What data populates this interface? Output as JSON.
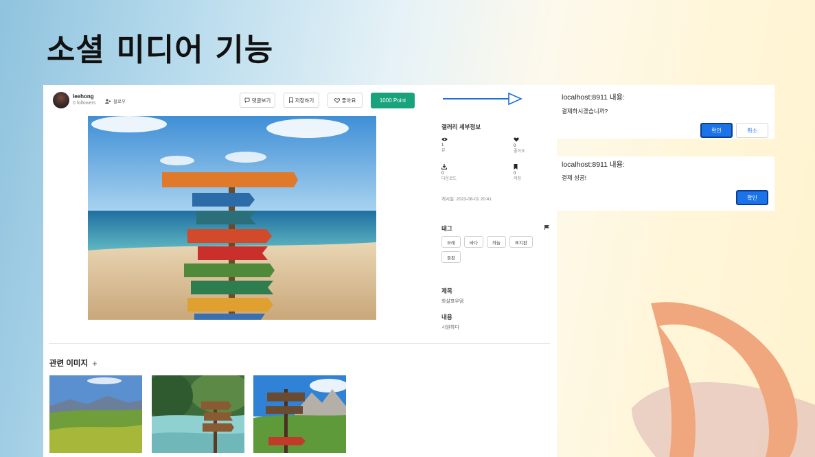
{
  "slide": {
    "title": "소셜 미디어 기능"
  },
  "post": {
    "username": "leehong",
    "followers": "0 followers",
    "follow_label": "팔로우",
    "buttons": {
      "comments": "댓글보기",
      "save": "저장하기",
      "like": "좋아요",
      "point": "1000 Point"
    }
  },
  "details": {
    "heading": "갤러리 세부정보",
    "stats": [
      {
        "icon": "eye-icon",
        "value": "1",
        "label": "뷰"
      },
      {
        "icon": "heart-icon",
        "value": "0",
        "label": "좋아요"
      },
      {
        "icon": "download-icon",
        "value": "0",
        "label": "다운로드"
      },
      {
        "icon": "bookmark-icon",
        "value": "0",
        "label": "저장"
      }
    ],
    "posted_at": "게시일: 2023-08-01 20:41",
    "tags_heading": "태그",
    "tags": [
      "모래",
      "바다",
      "하늘",
      "표지판",
      "들판"
    ],
    "title_heading": "제목",
    "title_value": "화살표우뎀",
    "content_heading": "내용",
    "content_value": "시원하다"
  },
  "related": {
    "heading": "관련 이미지",
    "plus": "+"
  },
  "dialogs": {
    "confirm": {
      "title": "localhost:8911 내용:",
      "message": "결제하시겠습니까?",
      "ok": "확인",
      "cancel": "취소"
    },
    "success": {
      "title": "localhost:8911 내용:",
      "message": "결제 성공!",
      "ok": "확인"
    }
  },
  "colors": {
    "point_button": "#19a37d",
    "dialog_primary": "#1a73e8",
    "arrow": "#1e6fd9",
    "deco": "#f0a77e"
  }
}
